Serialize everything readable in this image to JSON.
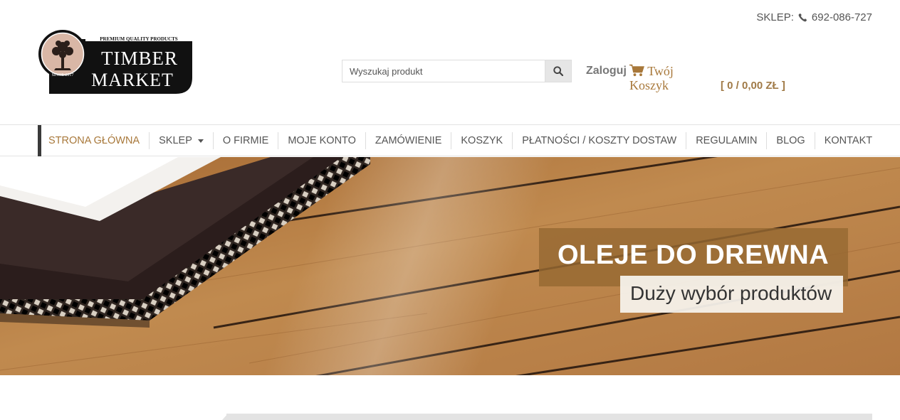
{
  "header": {
    "shop_label": "SKLEP:",
    "phone": "692-086-727",
    "logo": {
      "top_text": "PREMIUM QUALITY PRODUCTS",
      "brand_line1": "TIMBER",
      "brand_line2": "MARKET",
      "since": "SINCE 2017"
    },
    "search_placeholder": "Wyszukaj produkt",
    "login_label": "Zaloguj",
    "cart_label": "Twój Koszyk",
    "cart_total": "[ 0 / 0,00 ZŁ ]"
  },
  "nav": {
    "items": [
      {
        "label": "STRONA GŁÓWNA"
      },
      {
        "label": "SKLEP"
      },
      {
        "label": "O FIRMIE"
      },
      {
        "label": "MOJE KONTO"
      },
      {
        "label": "ZAMÓWIENIE"
      },
      {
        "label": "KOSZYK"
      },
      {
        "label": "PŁATNOŚCI / KOSZTY DOSTAW"
      },
      {
        "label": "REGULAMIN"
      },
      {
        "label": "BLOG"
      },
      {
        "label": "KONTAKT"
      }
    ]
  },
  "hero": {
    "title": "OLEJE DO DREWNA",
    "subtitle": "Duży wybór produktów"
  },
  "icons": {
    "phone": "phone-icon",
    "search": "search-icon",
    "cart": "cart-icon",
    "dropdown": "caret-down-icon"
  },
  "colors": {
    "accent": "#a8783a",
    "nav_active_bar": "#3a3a3a",
    "hero_title_bg": "#96693"
  }
}
